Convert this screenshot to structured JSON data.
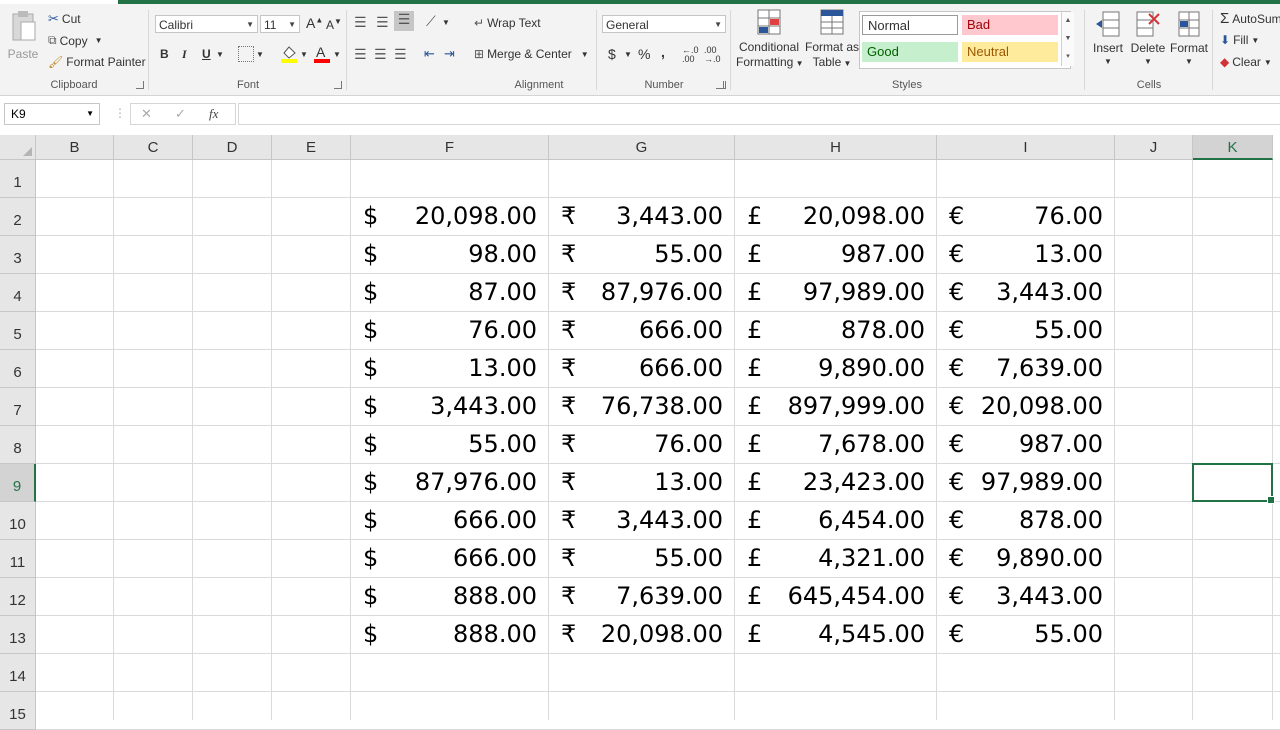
{
  "ribbon": {
    "clipboard": {
      "paste": "Paste",
      "cut": "Cut",
      "copy": "Copy",
      "format_painter": "Format Painter",
      "label": "Clipboard"
    },
    "font": {
      "name": "Calibri",
      "size": "11",
      "label": "Font",
      "bold": "B",
      "italic": "I",
      "underline": "U"
    },
    "alignment": {
      "wrap_text": "Wrap Text",
      "merge_center": "Merge & Center",
      "label": "Alignment"
    },
    "number": {
      "format": "General",
      "label": "Number",
      "currency": "$",
      "percent": "%",
      "comma": ","
    },
    "styles": {
      "conditional_formatting_1": "Conditional",
      "conditional_formatting_2": "Formatting",
      "format_as_table_1": "Format as",
      "format_as_table_2": "Table",
      "normal": "Normal",
      "bad": "Bad",
      "good": "Good",
      "neutral": "Neutral",
      "label": "Styles"
    },
    "cells": {
      "insert": "Insert",
      "delete": "Delete",
      "format": "Format",
      "label": "Cells"
    },
    "editing": {
      "autosum": "AutoSum",
      "fill": "Fill",
      "clear": "Clear"
    }
  },
  "formula_bar": {
    "name_box": "K9",
    "cancel": "✕",
    "enter": "✓",
    "fx": "fx",
    "content": ""
  },
  "columns": [
    "B",
    "C",
    "D",
    "E",
    "F",
    "G",
    "H",
    "I",
    "J",
    "K"
  ],
  "selected_column": "K",
  "selected_row": "9",
  "rows": [
    "1",
    "2",
    "3",
    "4",
    "5",
    "6",
    "7",
    "8",
    "9",
    "10",
    "11",
    "12",
    "13",
    "14",
    "15"
  ],
  "currency_symbols": {
    "F": "$",
    "G": "₹",
    "H": "£",
    "I": "€"
  },
  "table": [
    {
      "row": "2",
      "F": "20,098.00",
      "G": "3,443.00",
      "H": "20,098.00",
      "I": "76.00"
    },
    {
      "row": "3",
      "F": "98.00",
      "G": "55.00",
      "H": "987.00",
      "I": "13.00"
    },
    {
      "row": "4",
      "F": "87.00",
      "G": "87,976.00",
      "H": "97,989.00",
      "I": "3,443.00"
    },
    {
      "row": "5",
      "F": "76.00",
      "G": "666.00",
      "H": "878.00",
      "I": "55.00"
    },
    {
      "row": "6",
      "F": "13.00",
      "G": "666.00",
      "H": "9,890.00",
      "I": "7,639.00"
    },
    {
      "row": "7",
      "F": "3,443.00",
      "G": "76,738.00",
      "H": "897,999.00",
      "I": "20,098.00"
    },
    {
      "row": "8",
      "F": "55.00",
      "G": "76.00",
      "H": "7,678.00",
      "I": "987.00"
    },
    {
      "row": "9",
      "F": "87,976.00",
      "G": "13.00",
      "H": "23,423.00",
      "I": "97,989.00"
    },
    {
      "row": "10",
      "F": "666.00",
      "G": "3,443.00",
      "H": "6,454.00",
      "I": "878.00"
    },
    {
      "row": "11",
      "F": "666.00",
      "G": "55.00",
      "H": "4,321.00",
      "I": "9,890.00"
    },
    {
      "row": "12",
      "F": "888.00",
      "G": "7,639.00",
      "H": "645,454.00",
      "I": "3,443.00"
    },
    {
      "row": "13",
      "F": "888.00",
      "G": "20,098.00",
      "H": "4,545.00",
      "I": "55.00"
    }
  ],
  "colors": {
    "accent": "#217346",
    "bad_bg": "#ffc7ce",
    "bad_text": "#9c0006",
    "good_bg": "#c6efce",
    "good_text": "#006100",
    "neutral_bg": "#ffeb9c",
    "neutral_text": "#9c5700"
  }
}
